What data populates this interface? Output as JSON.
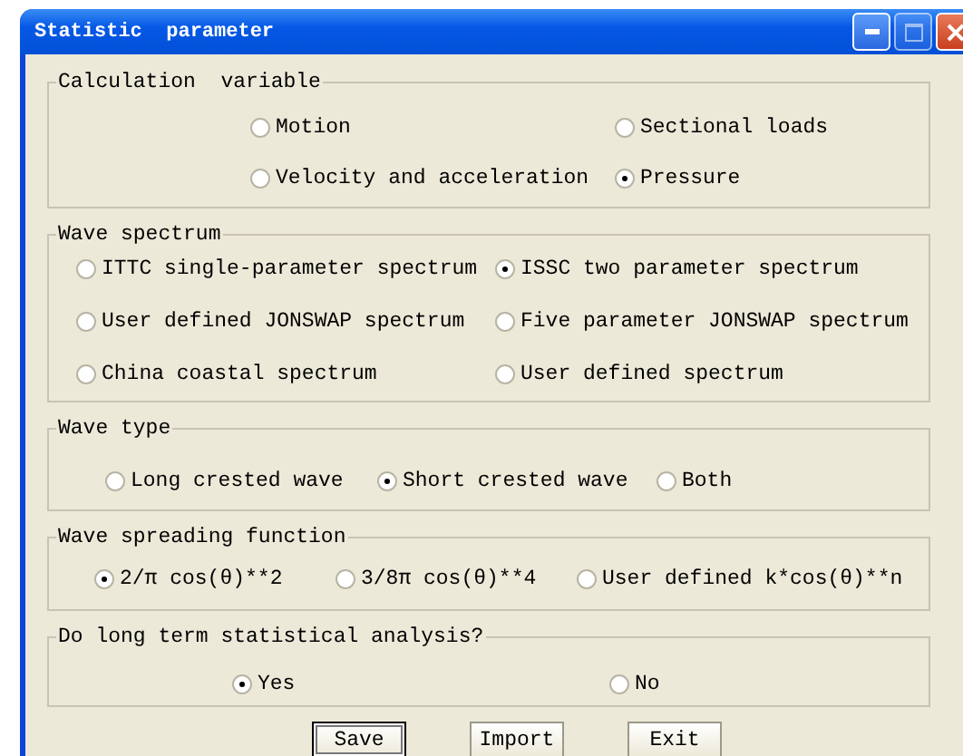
{
  "window": {
    "title": "Statistic  parameter"
  },
  "groups": [
    {
      "title": "Calculation  variable",
      "options": [
        {
          "label": "Motion",
          "selected": false
        },
        {
          "label": "Sectional loads",
          "selected": false
        },
        {
          "label": "Velocity and acceleration",
          "selected": false
        },
        {
          "label": "Pressure",
          "selected": true
        }
      ]
    },
    {
      "title": "Wave spectrum",
      "options": [
        {
          "label": "ITTC single-parameter spectrum",
          "selected": false
        },
        {
          "label": "ISSC two parameter spectrum",
          "selected": true
        },
        {
          "label": "User defined JONSWAP spectrum",
          "selected": false
        },
        {
          "label": "Five parameter JONSWAP spectrum",
          "selected": false
        },
        {
          "label": "China coastal spectrum",
          "selected": false
        },
        {
          "label": "User defined spectrum",
          "selected": false
        }
      ]
    },
    {
      "title": "Wave type",
      "options": [
        {
          "label": "Long crested wave",
          "selected": false
        },
        {
          "label": "Short crested wave",
          "selected": true
        },
        {
          "label": "Both",
          "selected": false
        }
      ]
    },
    {
      "title": "Wave spreading function",
      "options": [
        {
          "label": "2/π cos(θ)**2",
          "selected": true
        },
        {
          "label": "3/8π cos(θ)**4",
          "selected": false
        },
        {
          "label": "User defined k*cos(θ)**n",
          "selected": false
        }
      ]
    },
    {
      "title": "Do long term statistical analysis?",
      "options": [
        {
          "label": "Yes",
          "selected": true
        },
        {
          "label": "No",
          "selected": false
        }
      ]
    }
  ],
  "buttons": [
    {
      "label": "Save",
      "focused": true
    },
    {
      "label": "Import",
      "focused": false
    },
    {
      "label": "Exit",
      "focused": false
    }
  ]
}
